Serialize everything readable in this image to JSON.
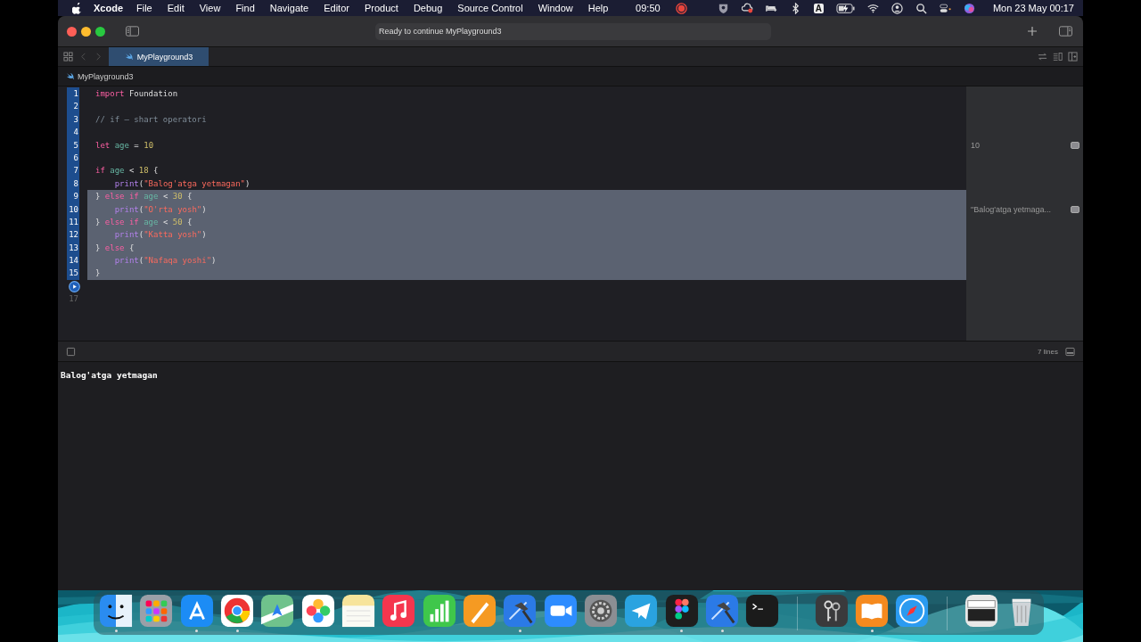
{
  "menu_bar": {
    "app": "Xcode",
    "menus": [
      "File",
      "Edit",
      "View",
      "Find",
      "Navigate",
      "Editor",
      "Product",
      "Debug",
      "Source Control",
      "Window",
      "Help"
    ],
    "recording_time": "09:50",
    "input_source": "A",
    "clock": "Mon 23 May  00:17"
  },
  "window": {
    "activity": "Ready to continue MyPlayground3",
    "tabs": [
      {
        "label": "MyPlayground3",
        "selected": true
      }
    ],
    "breadcrumb": "MyPlayground3",
    "editor": {
      "lines": [
        {
          "kind": "code",
          "number": "1",
          "executed": true,
          "selected": false,
          "tokens": [
            {
              "t": "import",
              "kind": "keyword"
            },
            {
              "t": " Foundation",
              "kind": "plain"
            }
          ]
        },
        {
          "kind": "code",
          "number": "2",
          "executed": true,
          "selected": false
        },
        {
          "kind": "code",
          "number": "3",
          "executed": true,
          "selected": false,
          "tokens": [
            {
              "t": "// if – shart operatori",
              "kind": "comment"
            }
          ]
        },
        {
          "kind": "code",
          "number": "4",
          "executed": true,
          "selected": false
        },
        {
          "kind": "code",
          "number": "5",
          "executed": true,
          "selected": false,
          "result": "10",
          "tokens": [
            {
              "t": "let",
              "kind": "keyword"
            },
            {
              "t": " age",
              "kind": "var"
            },
            {
              "t": " = ",
              "kind": "plain"
            },
            {
              "t": "10",
              "kind": "number"
            }
          ]
        },
        {
          "kind": "code",
          "number": "6",
          "executed": true,
          "selected": false
        },
        {
          "kind": "code",
          "number": "7",
          "executed": true,
          "selected": false,
          "tokens": [
            {
              "t": "if",
              "kind": "keyword"
            },
            {
              "t": " age",
              "kind": "var"
            },
            {
              "t": " < ",
              "kind": "plain"
            },
            {
              "t": "18",
              "kind": "number"
            },
            {
              "t": " {",
              "kind": "plain"
            }
          ]
        },
        {
          "kind": "code",
          "number": "8",
          "executed": true,
          "selected": false,
          "tokens": [
            {
              "t": "    print",
              "kind": "func"
            },
            {
              "t": "(",
              "kind": "plain"
            },
            {
              "t": "\"Balog'atga yetmagan\"",
              "kind": "string"
            },
            {
              "t": ")",
              "kind": "plain"
            }
          ]
        },
        {
          "kind": "code",
          "number": "9",
          "executed": true,
          "selected": true,
          "tokens": [
            {
              "t": "} ",
              "kind": "plain"
            },
            {
              "t": "else if",
              "kind": "keyword"
            },
            {
              "t": " age",
              "kind": "var"
            },
            {
              "t": " < ",
              "kind": "plain"
            },
            {
              "t": "30",
              "kind": "number"
            },
            {
              "t": " {",
              "kind": "plain"
            }
          ]
        },
        {
          "kind": "code",
          "number": "10",
          "executed": true,
          "selected": true,
          "result": "\"Balog'atga yetmaga...",
          "tokens": [
            {
              "t": "    print",
              "kind": "func"
            },
            {
              "t": "(",
              "kind": "plain"
            },
            {
              "t": "\"O'rta yosh\"",
              "kind": "string"
            },
            {
              "t": ")",
              "kind": "plain"
            }
          ]
        },
        {
          "kind": "code",
          "number": "11",
          "executed": true,
          "selected": true,
          "tokens": [
            {
              "t": "} ",
              "kind": "plain"
            },
            {
              "t": "else if",
              "kind": "keyword"
            },
            {
              "t": " age",
              "kind": "var"
            },
            {
              "t": " < ",
              "kind": "plain"
            },
            {
              "t": "50",
              "kind": "number"
            },
            {
              "t": " {",
              "kind": "plain"
            }
          ]
        },
        {
          "kind": "code",
          "number": "12",
          "executed": true,
          "selected": true,
          "tokens": [
            {
              "t": "    print",
              "kind": "func"
            },
            {
              "t": "(",
              "kind": "plain"
            },
            {
              "t": "\"Katta yosh\"",
              "kind": "string"
            },
            {
              "t": ")",
              "kind": "plain"
            }
          ]
        },
        {
          "kind": "code",
          "number": "13",
          "executed": true,
          "selected": true,
          "tokens": [
            {
              "t": "} ",
              "kind": "plain"
            },
            {
              "t": "else",
              "kind": "keyword"
            },
            {
              "t": " {",
              "kind": "plain"
            }
          ]
        },
        {
          "kind": "code",
          "number": "14",
          "executed": true,
          "selected": true,
          "tokens": [
            {
              "t": "    print",
              "kind": "func"
            },
            {
              "t": "(",
              "kind": "plain"
            },
            {
              "t": "\"Nafaqa yoshi\"",
              "kind": "string"
            },
            {
              "t": ")",
              "kind": "plain"
            }
          ]
        },
        {
          "kind": "code",
          "number": "15",
          "executed": true,
          "selected": true,
          "tokens": [
            {
              "t": "}",
              "kind": "plain"
            }
          ]
        },
        {
          "kind": "run"
        },
        {
          "kind": "code",
          "number": "17",
          "executed": false,
          "selected": false
        }
      ]
    },
    "debug_bar": {
      "line_count": "7 lines"
    },
    "console": {
      "output": "Balog'atga yetmagan"
    }
  },
  "dock": {
    "apps": [
      {
        "kind": "finder",
        "running": true
      },
      {
        "kind": "launchpad",
        "running": false
      },
      {
        "kind": "appstore",
        "running": true
      },
      {
        "kind": "chrome",
        "running": true
      },
      {
        "kind": "maps",
        "running": false
      },
      {
        "kind": "photos",
        "running": false
      },
      {
        "kind": "notes",
        "running": false
      },
      {
        "kind": "music",
        "running": false
      },
      {
        "kind": "numbers",
        "running": false
      },
      {
        "kind": "pages",
        "running": false
      },
      {
        "kind": "xcode",
        "running": true
      },
      {
        "kind": "zoom",
        "running": false
      },
      {
        "kind": "settings",
        "running": false
      },
      {
        "kind": "telegram",
        "running": false
      },
      {
        "kind": "figma",
        "running": true
      },
      {
        "kind": "xcodebeta",
        "running": true
      },
      {
        "kind": "terminal",
        "running": false
      },
      {
        "kind": "separator"
      },
      {
        "kind": "keychain",
        "running": false
      },
      {
        "kind": "books",
        "running": true
      },
      {
        "kind": "safari",
        "running": false
      },
      {
        "kind": "separator"
      },
      {
        "kind": "stack",
        "running": false
      },
      {
        "kind": "trash",
        "running": false
      }
    ]
  }
}
